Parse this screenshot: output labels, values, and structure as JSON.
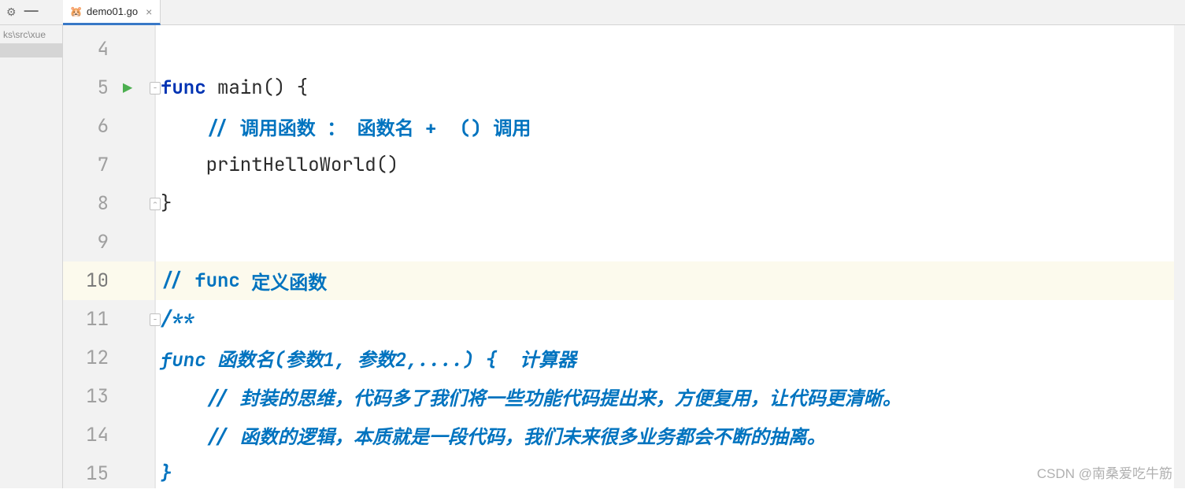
{
  "toolbar": {
    "gear_icon": "⚙",
    "minimize_icon": "—"
  },
  "tab": {
    "icon": "🐹",
    "label": "demo01.go",
    "close": "×"
  },
  "sidebar": {
    "path": "ks\\src\\xue"
  },
  "code": {
    "lines": [
      {
        "num": "4",
        "parts": []
      },
      {
        "num": "5",
        "run": true,
        "fold": true,
        "parts": [
          {
            "t": "func",
            "c": "kw"
          },
          {
            "t": " main() {",
            "c": ""
          }
        ]
      },
      {
        "num": "6",
        "parts": [
          {
            "t": "    ",
            "c": ""
          },
          {
            "t": "// 调用函数 ： 函数名 +  () 调用",
            "c": "comment"
          }
        ]
      },
      {
        "num": "7",
        "parts": [
          {
            "t": "    printHelloWorld()",
            "c": ""
          }
        ]
      },
      {
        "num": "8",
        "foldEnd": true,
        "parts": [
          {
            "t": "}",
            "c": ""
          }
        ]
      },
      {
        "num": "9",
        "parts": []
      },
      {
        "num": "10",
        "current": true,
        "parts": [
          {
            "t": "// ",
            "c": "comment"
          },
          {
            "t": "func",
            "c": "comment"
          },
          {
            "t": " 定义函数",
            "c": "comment"
          }
        ]
      },
      {
        "num": "11",
        "fold": true,
        "parts": [
          {
            "t": "/**",
            "c": "comment-it"
          }
        ]
      },
      {
        "num": "12",
        "parts": [
          {
            "t": "func 函数名(参数1, 参数2,....) {  计算器",
            "c": "comment-it"
          }
        ]
      },
      {
        "num": "13",
        "parts": [
          {
            "t": "    // 封装的思维，代码多了我们将一些功能代码提出来，方便复用，让代码更清晰。",
            "c": "comment-it"
          }
        ]
      },
      {
        "num": "14",
        "parts": [
          {
            "t": "    // 函数的逻辑，本质就是一段代码，我们未来很多业务都会不断的抽离。",
            "c": "comment-it"
          }
        ]
      },
      {
        "num": "15",
        "parts": [
          {
            "t": "}",
            "c": "comment-it"
          }
        ]
      }
    ]
  },
  "watermark": "CSDN @南桑爱吃牛筋"
}
